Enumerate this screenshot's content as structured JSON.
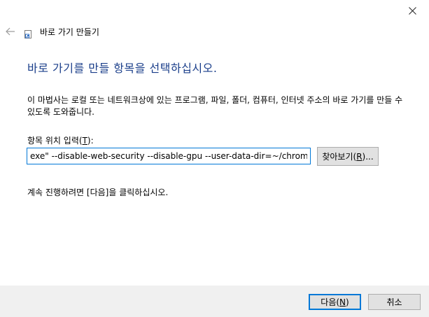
{
  "window": {
    "title": "바로 가기 만들기",
    "app_icon": "shortcut-wizard-icon",
    "back_icon": "back-arrow-icon",
    "close_icon": "close-icon"
  },
  "main": {
    "heading": "바로 가기를 만들 항목을 선택하십시오.",
    "description": "이 마법사는 로컬 또는 네트워크상에 있는 프로그램, 파일, 폴더, 컴퓨터, 인터넷 주소의 바로 가기를 만들 수 있도록 도와줍니다.",
    "location_label_prefix": "항목 위치 입력(",
    "location_label_key": "T",
    "location_label_suffix": "):",
    "location_value": "exe\" --disable-web-security --disable-gpu --user-data-dir=~/chromeTemp",
    "browse_label_prefix": "찾아보기(",
    "browse_label_key": "R",
    "browse_label_suffix": ")...",
    "hint": "계속 진행하려면 [다음]을 클릭하십시오."
  },
  "footer": {
    "next_label_prefix": "다음(",
    "next_label_key": "N",
    "next_label_suffix": ")",
    "cancel_label": "취소"
  },
  "colors": {
    "heading": "#1a3e8a",
    "focus_border": "#0078d7",
    "footer_bg": "#f0f0f0",
    "button_bg": "#e1e1e1"
  }
}
